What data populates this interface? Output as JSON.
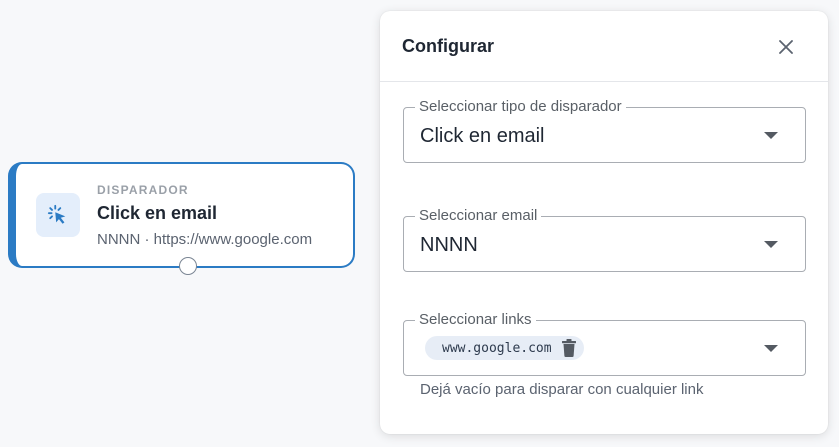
{
  "node": {
    "kicker": "DISPARADOR",
    "title": "Click en email",
    "subtitle": "NNNN · https://www.google.com",
    "icon": "cursor-click-icon",
    "accent_color": "#2b7bc4"
  },
  "panel": {
    "title": "Configurar",
    "close_icon": "close-icon",
    "trigger_type": {
      "label": "Seleccionar tipo de disparador",
      "value": "Click en email"
    },
    "email": {
      "label": "Seleccionar email",
      "value": "NNNN"
    },
    "links": {
      "label": "Seleccionar links",
      "chips": [
        "www.google.com"
      ],
      "helper": "Dejá vacío para disparar con cualquier link"
    }
  }
}
